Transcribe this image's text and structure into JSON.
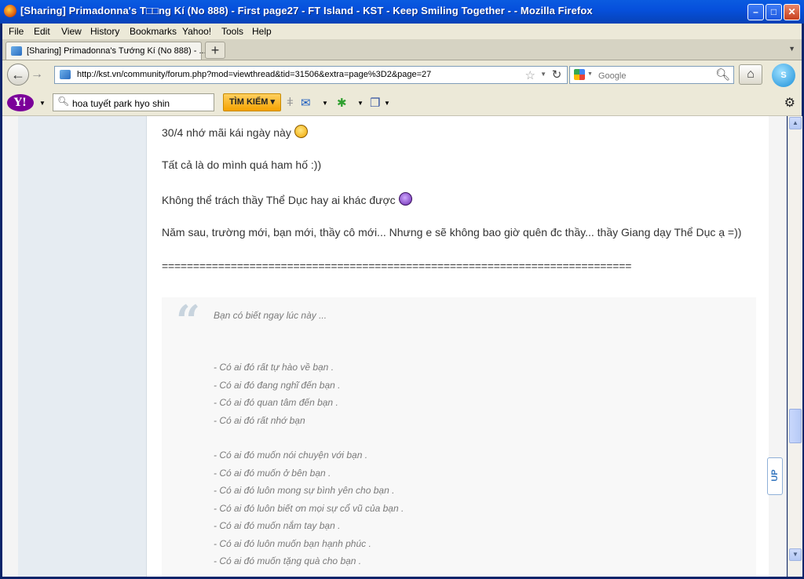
{
  "window": {
    "title": "[Sharing] Primadonna's T□□ng Kí (No 888) - First page27 - FT Island - KST - Keep Smiling Together - - Mozilla Firefox",
    "minimize": "–",
    "maximize": "□",
    "close": "✕"
  },
  "menu": [
    "File",
    "Edit",
    "View",
    "History",
    "Bookmarks",
    "Yahoo!",
    "Tools",
    "Help"
  ],
  "tab": {
    "label": "[Sharing] Primadonna's Tướng Kí (No 888) - ...",
    "new_tab": "+"
  },
  "nav": {
    "url": "http://kst.vn/community/forum.php?mod=viewthread&tid=31506&extra=page%3D2&page=27",
    "search_placeholder": "Google"
  },
  "yahoo": {
    "search_value": "hoa tuyết park hyo shin",
    "search_button": "TÌM KIẾM"
  },
  "post": {
    "lines": [
      "30/4 nhớ mãi kái ngày này",
      "Tất cả là do mình quá ham hố :))",
      "Không thể trách thầy Thể Dục hay ai khác được",
      "Năm sau, trường mới, bạn mới, thầy cô mới... Nhưng e sẽ không bao giờ quên đc thầy... thầy Giang dạy Thể Dục ạ =))",
      "==========================================================================="
    ],
    "quote": [
      "Bạn có biết ngay lúc này ...",
      "- Có ai đó rất tự hào về bạn .",
      "- Có ai đó đang nghĩ đến bạn .",
      "- Có ai đó quan tâm đến bạn .",
      "- Có ai đó rất nhớ bạn",
      "- Có ai đó muốn nói chuyện với bạn .",
      "- Có ai đó muốn ở bên bạn .",
      "- Có ai đó luôn mong sự bình yên cho bạn .",
      "- Có ai đó luôn biết ơn mọi sự cổ vũ của bạn .",
      "- Có ai đó muốn nắm tay bạn .",
      "- Có ai đó luôn muốn bạn hạnh phúc .",
      "- Có ai đó muốn tặng quà cho bạn ."
    ]
  },
  "up_button": "UP"
}
